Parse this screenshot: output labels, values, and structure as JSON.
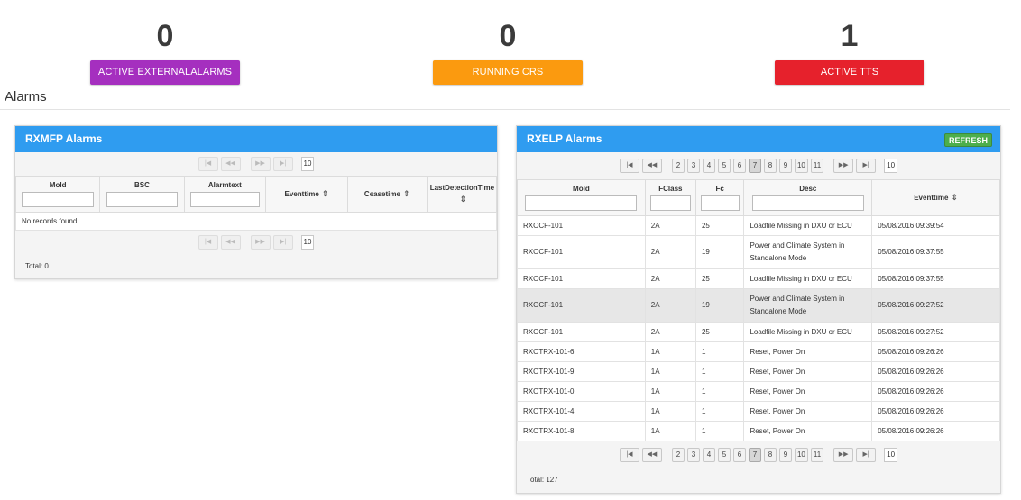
{
  "stats": [
    {
      "count": "0",
      "label": "ACTIVE EXTERNALALARMS",
      "color": "#a52fbf"
    },
    {
      "count": "0",
      "label": "RUNNING CRS",
      "color": "#fb9a0f"
    },
    {
      "count": "1",
      "label": "ACTIVE TTS",
      "color": "#e6212c"
    }
  ],
  "section_title": "Alarms",
  "rxmfp": {
    "title": "RXMFP Alarms",
    "columns": [
      "MoId",
      "BSC",
      "Alarmtext",
      "Eventtime",
      "Ceasetime",
      "LastDetectionTime"
    ],
    "empty_message": "No records found.",
    "rows_per_page": "10",
    "total": "Total: 0"
  },
  "rxelp": {
    "title": "RXELP Alarms",
    "refresh_label": "REFRESH",
    "columns": [
      "MoId",
      "FClass",
      "Fc",
      "Desc",
      "Eventtime"
    ],
    "pages": [
      "2",
      "3",
      "4",
      "5",
      "6",
      "7",
      "8",
      "9",
      "10",
      "11"
    ],
    "active_page": "7",
    "rows_per_page": "10",
    "rows": [
      {
        "moid": "RXOCF-101",
        "fclass": "2A",
        "fc": "25",
        "desc": "Loadfile Missing in DXU or ECU",
        "eventtime": "05/08/2016 09:39:54"
      },
      {
        "moid": "RXOCF-101",
        "fclass": "2A",
        "fc": "19",
        "desc": "Power and Climate System in Standalone Mode",
        "eventtime": "05/08/2016 09:37:55"
      },
      {
        "moid": "RXOCF-101",
        "fclass": "2A",
        "fc": "25",
        "desc": "Loadfile Missing in DXU or ECU",
        "eventtime": "05/08/2016 09:37:55"
      },
      {
        "moid": "RXOCF-101",
        "fclass": "2A",
        "fc": "19",
        "desc": "Power and Climate System in Standalone Mode",
        "eventtime": "05/08/2016 09:27:52"
      },
      {
        "moid": "RXOCF-101",
        "fclass": "2A",
        "fc": "25",
        "desc": "Loadfile Missing in DXU or ECU",
        "eventtime": "05/08/2016 09:27:52"
      },
      {
        "moid": "RXOTRX-101-6",
        "fclass": "1A",
        "fc": "1",
        "desc": "Reset, Power On",
        "eventtime": "05/08/2016 09:26:26"
      },
      {
        "moid": "RXOTRX-101-9",
        "fclass": "1A",
        "fc": "1",
        "desc": "Reset, Power On",
        "eventtime": "05/08/2016 09:26:26"
      },
      {
        "moid": "RXOTRX-101-0",
        "fclass": "1A",
        "fc": "1",
        "desc": "Reset, Power On",
        "eventtime": "05/08/2016 09:26:26"
      },
      {
        "moid": "RXOTRX-101-4",
        "fclass": "1A",
        "fc": "1",
        "desc": "Reset, Power On",
        "eventtime": "05/08/2016 09:26:26"
      },
      {
        "moid": "RXOTRX-101-8",
        "fclass": "1A",
        "fc": "1",
        "desc": "Reset, Power On",
        "eventtime": "05/08/2016 09:26:26"
      }
    ],
    "total": "Total: 127"
  }
}
